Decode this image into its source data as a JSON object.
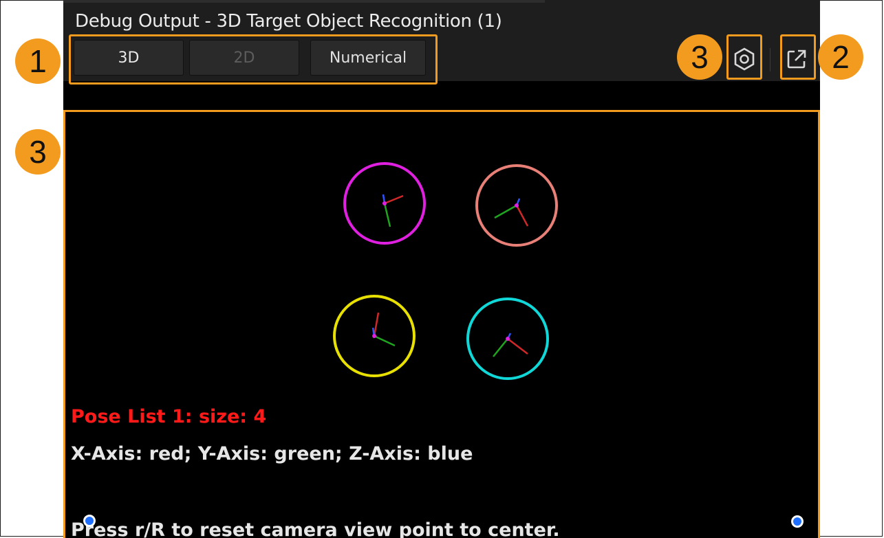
{
  "window": {
    "title": "Debug Output - 3D Target Object Recognition (1)"
  },
  "tabs": [
    {
      "label": "3D",
      "state": "active"
    },
    {
      "label": "2D",
      "state": "disabled"
    },
    {
      "label": "Numerical",
      "state": "normal"
    }
  ],
  "toolbar": {
    "settings_icon": "hexagon-settings-icon",
    "popout_icon": "external-link-icon"
  },
  "annotations": {
    "tabs_badge": "1",
    "popout_badge": "2",
    "settings_badge": "3",
    "viewport_badge": "3"
  },
  "viewport": {
    "pose_list_label": "Pose List 1: size: 4",
    "axis_legend": "X-Axis: red; Y-Axis: green; Z-Axis: blue",
    "reset_hint": "Press r/R to reset camera view point to center.",
    "poses": [
      {
        "ring_color": "#e020e0"
      },
      {
        "ring_color": "#e88078"
      },
      {
        "ring_color": "#e8e000"
      },
      {
        "ring_color": "#10d8d8"
      }
    ]
  },
  "colors": {
    "accent": "#f39b1f",
    "pose_label": "#ff1a1a",
    "text": "#e6e6e6",
    "axis_x": "#e02020",
    "axis_y": "#20b020",
    "axis_z": "#3060ff"
  }
}
